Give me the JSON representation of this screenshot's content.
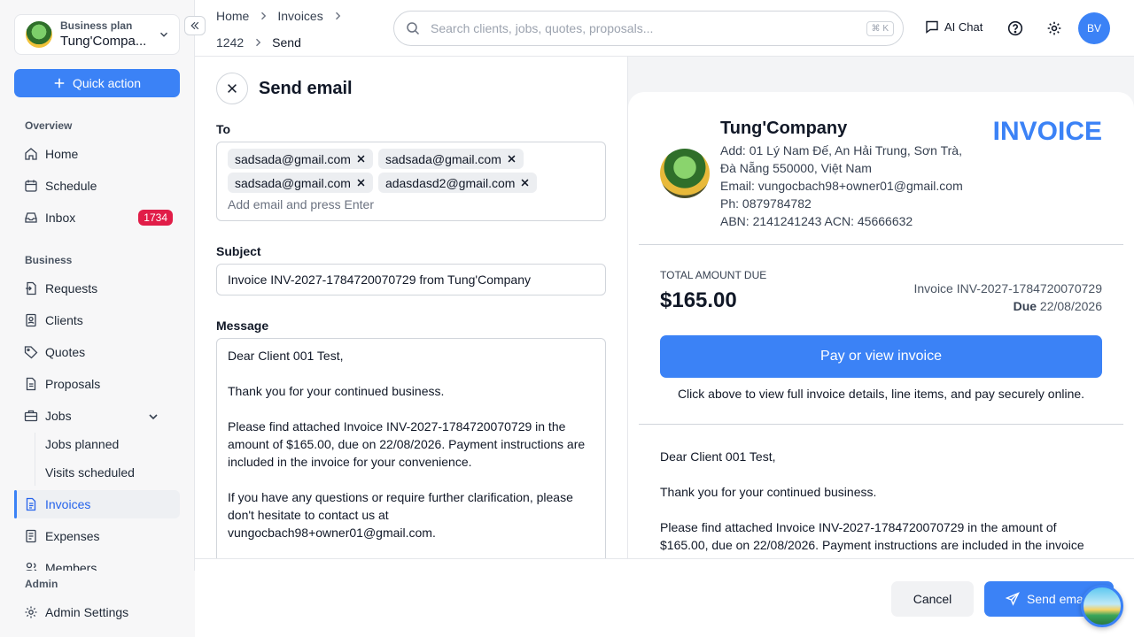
{
  "sidebar": {
    "plan": "Business plan",
    "company": "Tung'Compa...",
    "quick_action": "Quick action",
    "sections": {
      "overview": "Overview",
      "business": "Business",
      "admin": "Admin"
    },
    "items": {
      "home": "Home",
      "schedule": "Schedule",
      "inbox": "Inbox",
      "inbox_badge": "1734",
      "requests": "Requests",
      "clients": "Clients",
      "quotes": "Quotes",
      "proposals": "Proposals",
      "jobs": "Jobs",
      "jobs_planned": "Jobs planned",
      "visits_scheduled": "Visits scheduled",
      "invoices": "Invoices",
      "expenses": "Expenses",
      "members": "Members",
      "admin_settings": "Admin Settings"
    }
  },
  "header": {
    "breadcrumb": [
      "Home",
      "Invoices",
      "1242",
      "Send"
    ],
    "search_placeholder": "Search clients, jobs, quotes, proposals...",
    "search_shortcut": "⌘ K",
    "ai_chat": "AI Chat",
    "avatar_initials": "BV"
  },
  "form": {
    "title": "Send email",
    "to_label": "To",
    "recipients": [
      "sadsada@gmail.com",
      "sadsada@gmail.com",
      "sadsada@gmail.com",
      "adasdasd2@gmail.com"
    ],
    "to_placeholder": "Add email and press Enter",
    "subject_label": "Subject",
    "subject": "Invoice INV-2027-1784720070729 from Tung'Company",
    "message_label": "Message",
    "message": [
      "Dear Client 001 Test,",
      "Thank you for your continued business.",
      "Please find attached Invoice INV-2027-1784720070729 in the amount of $165.00, due on 22/08/2026. Payment instructions are included in the invoice for your convenience.",
      "If you have any questions or require further clarification, please don't hesitate to contact us at vungocbach98+owner01@gmail.com."
    ]
  },
  "preview": {
    "company_name": "Tung'Company",
    "invoice_word": "INVOICE",
    "address_line1": "Add: 01 Lý Nam Đế, An Hải Trung, Sơn Trà,",
    "address_line2": "Đà Nẵng 550000, Việt Nam",
    "email": "Email: vungocbach98+owner01@gmail.com",
    "phone": "Ph: 0879784782",
    "abn": "ABN: 2141241243 ACN: 45666632",
    "total_label": "TOTAL AMOUNT DUE",
    "total_amount": "$165.00",
    "invoice_number": "Invoice INV-2027-1784720070729",
    "due_label": "Due",
    "due_date": "22/08/2026",
    "pay_button": "Pay or view invoice",
    "pay_note": "Click above to view full invoice details, line items, and pay securely online.",
    "message": [
      "Dear Client 001 Test,",
      "Thank you for your continued business.",
      "Please find attached Invoice INV-2027-1784720070729 in the amount of $165.00, due on 22/08/2026. Payment instructions are included in the invoice for your convenience."
    ]
  },
  "footer": {
    "cancel": "Cancel",
    "send": "Send email"
  },
  "colors": {
    "accent": "#3b82f6",
    "badge": "#e11d48",
    "sidebar_bg": "#f7f7f8"
  }
}
